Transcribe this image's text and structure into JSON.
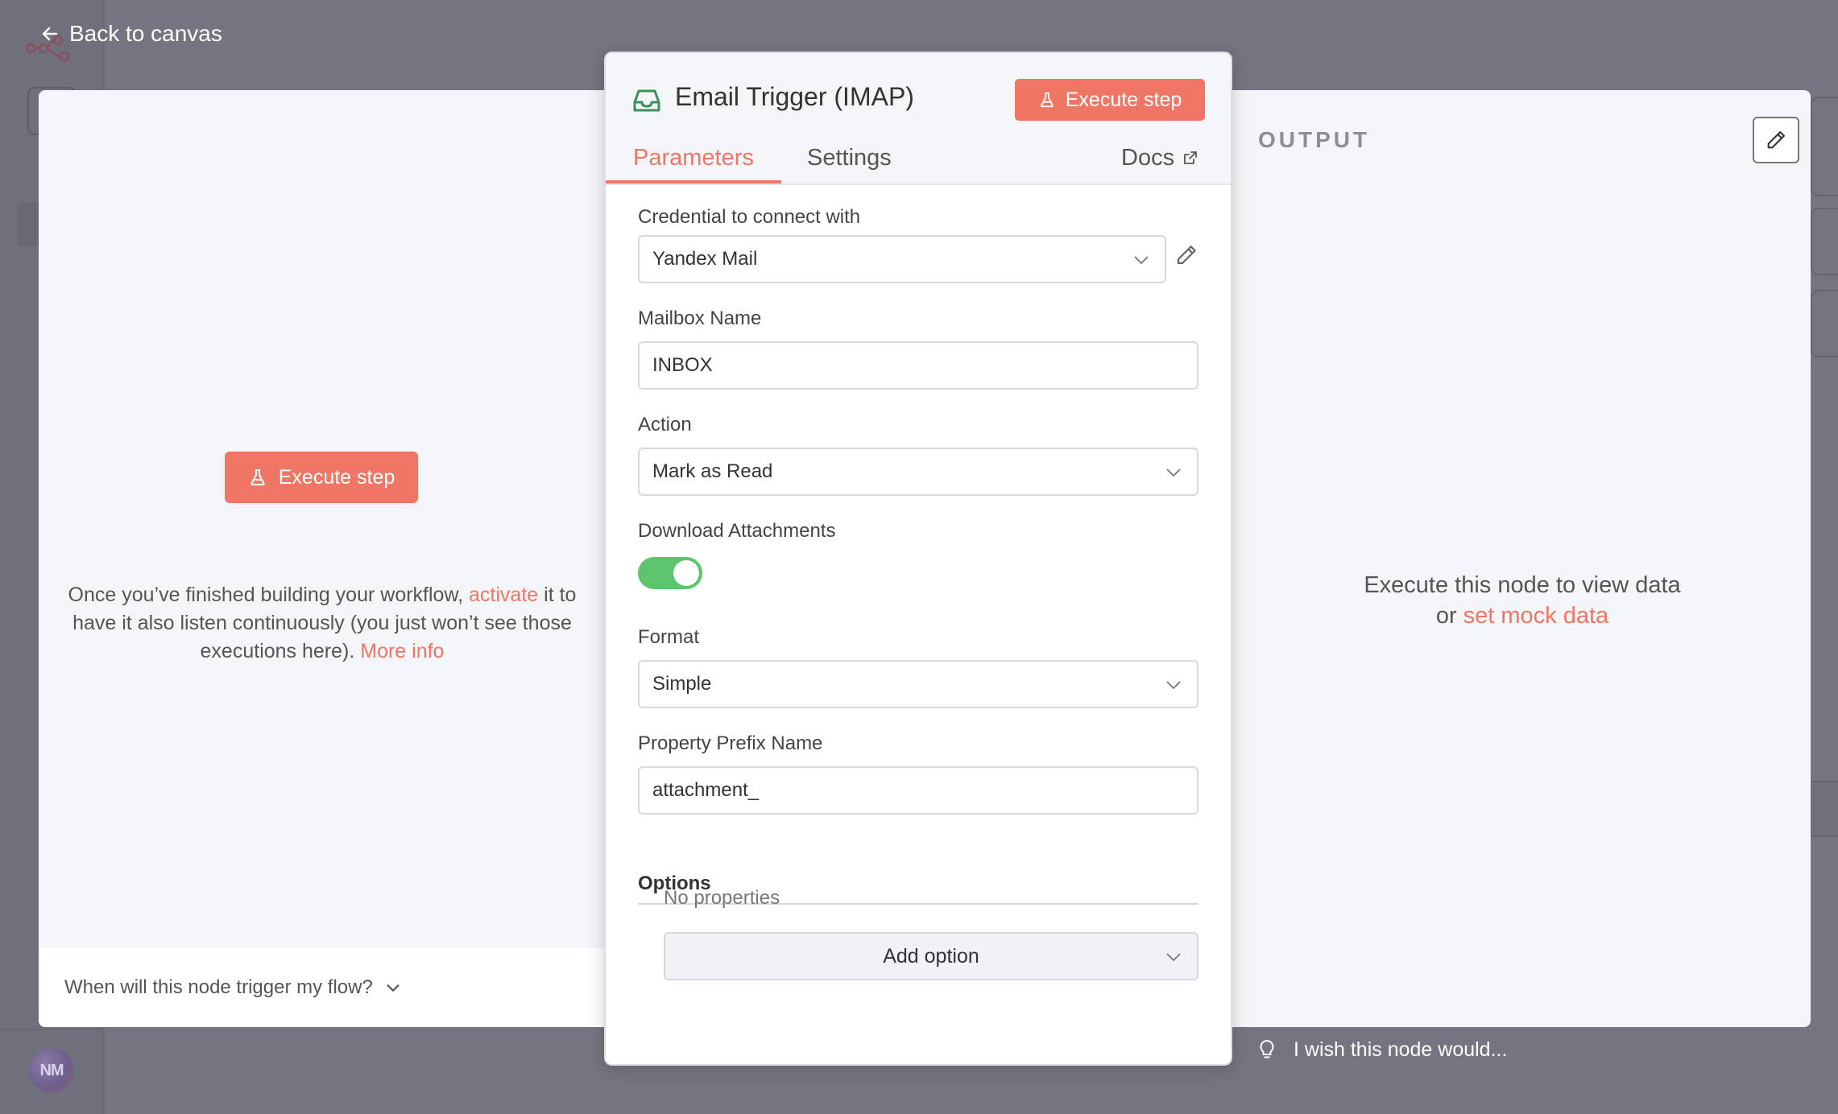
{
  "nav": {
    "back_label": "Back to canvas"
  },
  "user": {
    "initials": "NM"
  },
  "input_panel": {
    "execute_label": "Execute step",
    "hint_before": "Once you’ve finished building your workflow, ",
    "hint_link": "activate",
    "hint_after": " it to have it also listen continuously (you just won’t see those executions here).  ",
    "more_info": "More info",
    "footer_question": "When will this node trigger my flow?"
  },
  "node": {
    "title": "Email Trigger (IMAP)",
    "execute_label": "Execute step",
    "tabs": [
      {
        "label": "Parameters",
        "active": true
      },
      {
        "label": "Settings",
        "active": false
      },
      {
        "label": "Docs",
        "active": false
      }
    ],
    "fields": {
      "credential": {
        "label": "Credential to connect with",
        "value": "Yandex Mail"
      },
      "mailbox": {
        "label": "Mailbox Name",
        "value": "INBOX"
      },
      "action": {
        "label": "Action",
        "value": "Mark as Read"
      },
      "download": {
        "label": "Download Attachments",
        "enabled": true
      },
      "format": {
        "label": "Format",
        "value": "Simple"
      },
      "prefix": {
        "label": "Property Prefix Name",
        "value": "attachment_"
      }
    },
    "options": {
      "label": "Options",
      "empty_text": "No properties",
      "add_label": "Add option"
    }
  },
  "output_panel": {
    "label": "OUTPUT",
    "message_line1": "Execute this node to view data",
    "message_or": "or ",
    "message_link": "set mock data",
    "wish_label": "I wish this node would..."
  },
  "colors": {
    "accent": "#ef7664",
    "toggle_on": "#5cc46d",
    "icon_green": "#3f8f5c"
  }
}
